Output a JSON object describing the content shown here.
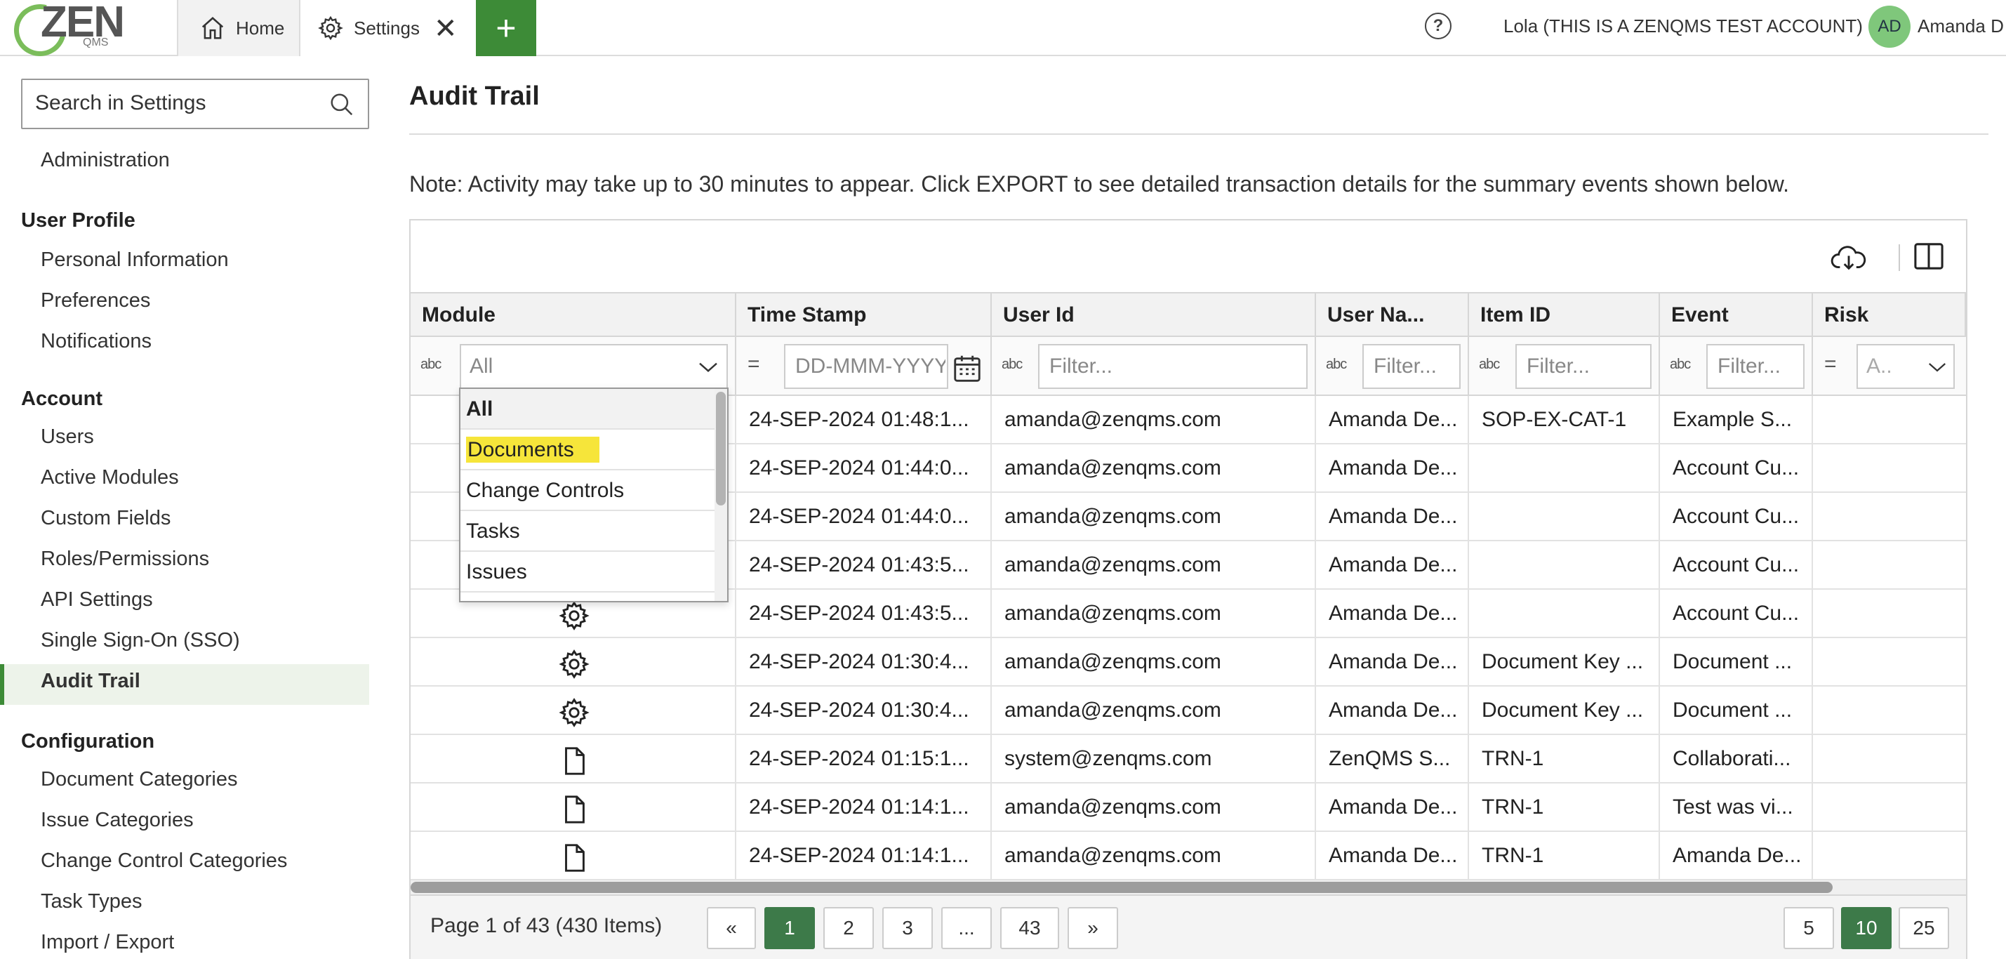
{
  "header": {
    "logo_text": "ZEN",
    "logo_sub": "QMS",
    "tabs": [
      {
        "label": "Home"
      },
      {
        "label": "Settings"
      }
    ],
    "add_tab_label": "+",
    "help_label": "?",
    "account_name": "Lola (THIS IS A ZENQMS TEST ACCOUNT)",
    "avatar_initials": "AD",
    "user_name": "Amanda D"
  },
  "sidebar": {
    "search_placeholder": "Search in Settings",
    "administration": "Administration",
    "sections": [
      {
        "title": "User Profile",
        "items": [
          "Personal Information",
          "Preferences",
          "Notifications"
        ]
      },
      {
        "title": "Account",
        "items": [
          "Users",
          "Active Modules",
          "Custom Fields",
          "Roles/Permissions",
          "API Settings",
          "Single Sign-On (SSO)",
          "Audit Trail"
        ]
      },
      {
        "title": "Configuration",
        "items": [
          "Document Categories",
          "Issue Categories",
          "Change Control Categories",
          "Task Types",
          "Import / Export"
        ]
      }
    ],
    "active_item": "Audit Trail"
  },
  "main": {
    "title": "Audit Trail",
    "note": "Note: Activity may take up to 30 minutes to appear. Click EXPORT to see detailed transaction details for the summary events shown below."
  },
  "grid": {
    "columns": [
      "Module",
      "Time Stamp",
      "User Id",
      "User Na...",
      "Item ID",
      "Event",
      "Risk"
    ],
    "filters": {
      "module_value": "All",
      "timestamp_placeholder": "DD-MMM-YYYY",
      "user_id_placeholder": "Filter...",
      "user_name_placeholder": "Filter...",
      "item_id_placeholder": "Filter...",
      "event_placeholder": "Filter...",
      "risk_value": "A.."
    },
    "filter_type_abc": "abc",
    "filter_type_eq": "=",
    "rows": [
      {
        "module_icon": "document-icon",
        "timestamp": "24-SEP-2024 01:48:1...",
        "user_id": "amanda@zenqms.com",
        "user_name": "Amanda De...",
        "item_id": "SOP-EX-CAT-1",
        "event": "Example S...",
        "risk": ""
      },
      {
        "module_icon": "gear-icon",
        "timestamp": "24-SEP-2024 01:44:0...",
        "user_id": "amanda@zenqms.com",
        "user_name": "Amanda De...",
        "item_id": "",
        "event": "Account Cu...",
        "risk": ""
      },
      {
        "module_icon": "gear-icon",
        "timestamp": "24-SEP-2024 01:44:0...",
        "user_id": "amanda@zenqms.com",
        "user_name": "Amanda De...",
        "item_id": "",
        "event": "Account Cu...",
        "risk": ""
      },
      {
        "module_icon": "gear-icon",
        "timestamp": "24-SEP-2024 01:43:5...",
        "user_id": "amanda@zenqms.com",
        "user_name": "Amanda De...",
        "item_id": "",
        "event": "Account Cu...",
        "risk": ""
      },
      {
        "module_icon": "gear-icon",
        "timestamp": "24-SEP-2024 01:43:5...",
        "user_id": "amanda@zenqms.com",
        "user_name": "Amanda De...",
        "item_id": "",
        "event": "Account Cu...",
        "risk": ""
      },
      {
        "module_icon": "gear-icon",
        "timestamp": "24-SEP-2024 01:30:4...",
        "user_id": "amanda@zenqms.com",
        "user_name": "Amanda De...",
        "item_id": "Document Key ...",
        "event": "Document ...",
        "risk": ""
      },
      {
        "module_icon": "gear-icon",
        "timestamp": "24-SEP-2024 01:30:4...",
        "user_id": "amanda@zenqms.com",
        "user_name": "Amanda De...",
        "item_id": "Document Key ...",
        "event": "Document ...",
        "risk": ""
      },
      {
        "module_icon": "document-icon",
        "timestamp": "24-SEP-2024 01:15:1...",
        "user_id": "system@zenqms.com",
        "user_name": "ZenQMS S...",
        "item_id": "TRN-1",
        "event": "Collaborati...",
        "risk": ""
      },
      {
        "module_icon": "document-icon",
        "timestamp": "24-SEP-2024 01:14:1...",
        "user_id": "amanda@zenqms.com",
        "user_name": "Amanda De...",
        "item_id": "TRN-1",
        "event": "Test was vi...",
        "risk": ""
      },
      {
        "module_icon": "document-icon",
        "timestamp": "24-SEP-2024 01:14:1...",
        "user_id": "amanda@zenqms.com",
        "user_name": "Amanda De...",
        "item_id": "TRN-1",
        "event": "Amanda De...",
        "risk": ""
      }
    ],
    "dropdown_options": [
      "All",
      "Documents",
      "Change Controls",
      "Tasks",
      "Issues"
    ],
    "dropdown_selected": "All",
    "dropdown_hover": "Documents"
  },
  "pager": {
    "info": "Page 1 of 43 (430 Items)",
    "prev": "«",
    "pages": [
      "1",
      "2",
      "3",
      "...",
      "43"
    ],
    "next": "»",
    "current_page": "1",
    "sizes": [
      "5",
      "10",
      "25"
    ],
    "current_size": "10"
  },
  "colors": {
    "brand_green": "#3d8b37",
    "active_page": "#3d7a49",
    "highlight_yellow": "#f6e53a"
  }
}
